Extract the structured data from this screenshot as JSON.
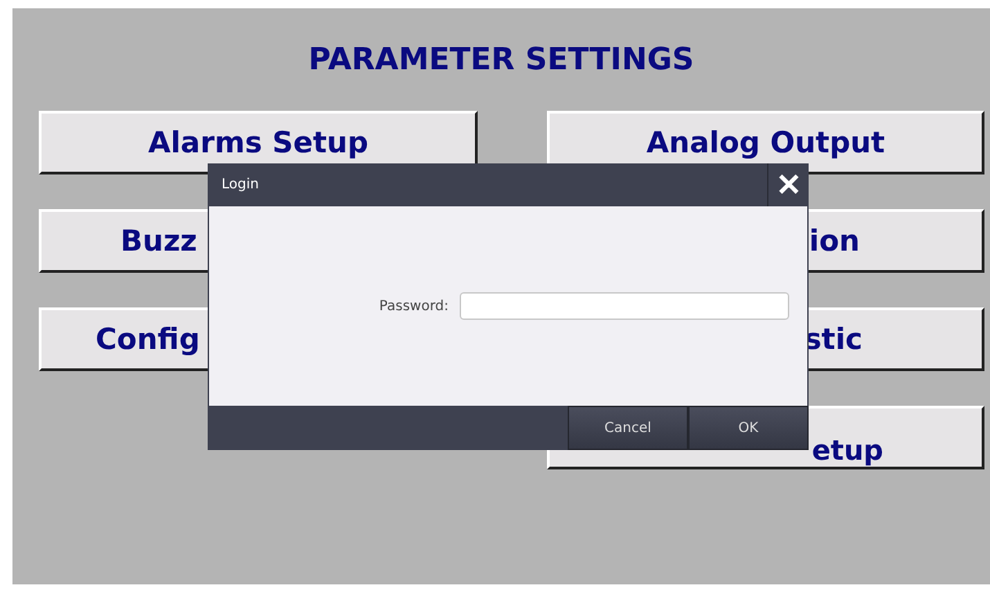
{
  "title": "PARAMETER SETTINGS",
  "buttons": [
    {
      "label": "Alarms Setup"
    },
    {
      "label": "Analog Output"
    },
    {
      "label": "Buzz"
    },
    {
      "label": "ion"
    },
    {
      "label": "Config"
    },
    {
      "label": "stic"
    },
    {
      "label": "etup"
    }
  ],
  "dialog": {
    "title": "Login",
    "close": "✕",
    "field_label": "Password:",
    "buttons": [
      "Cancel",
      "OK"
    ]
  }
}
